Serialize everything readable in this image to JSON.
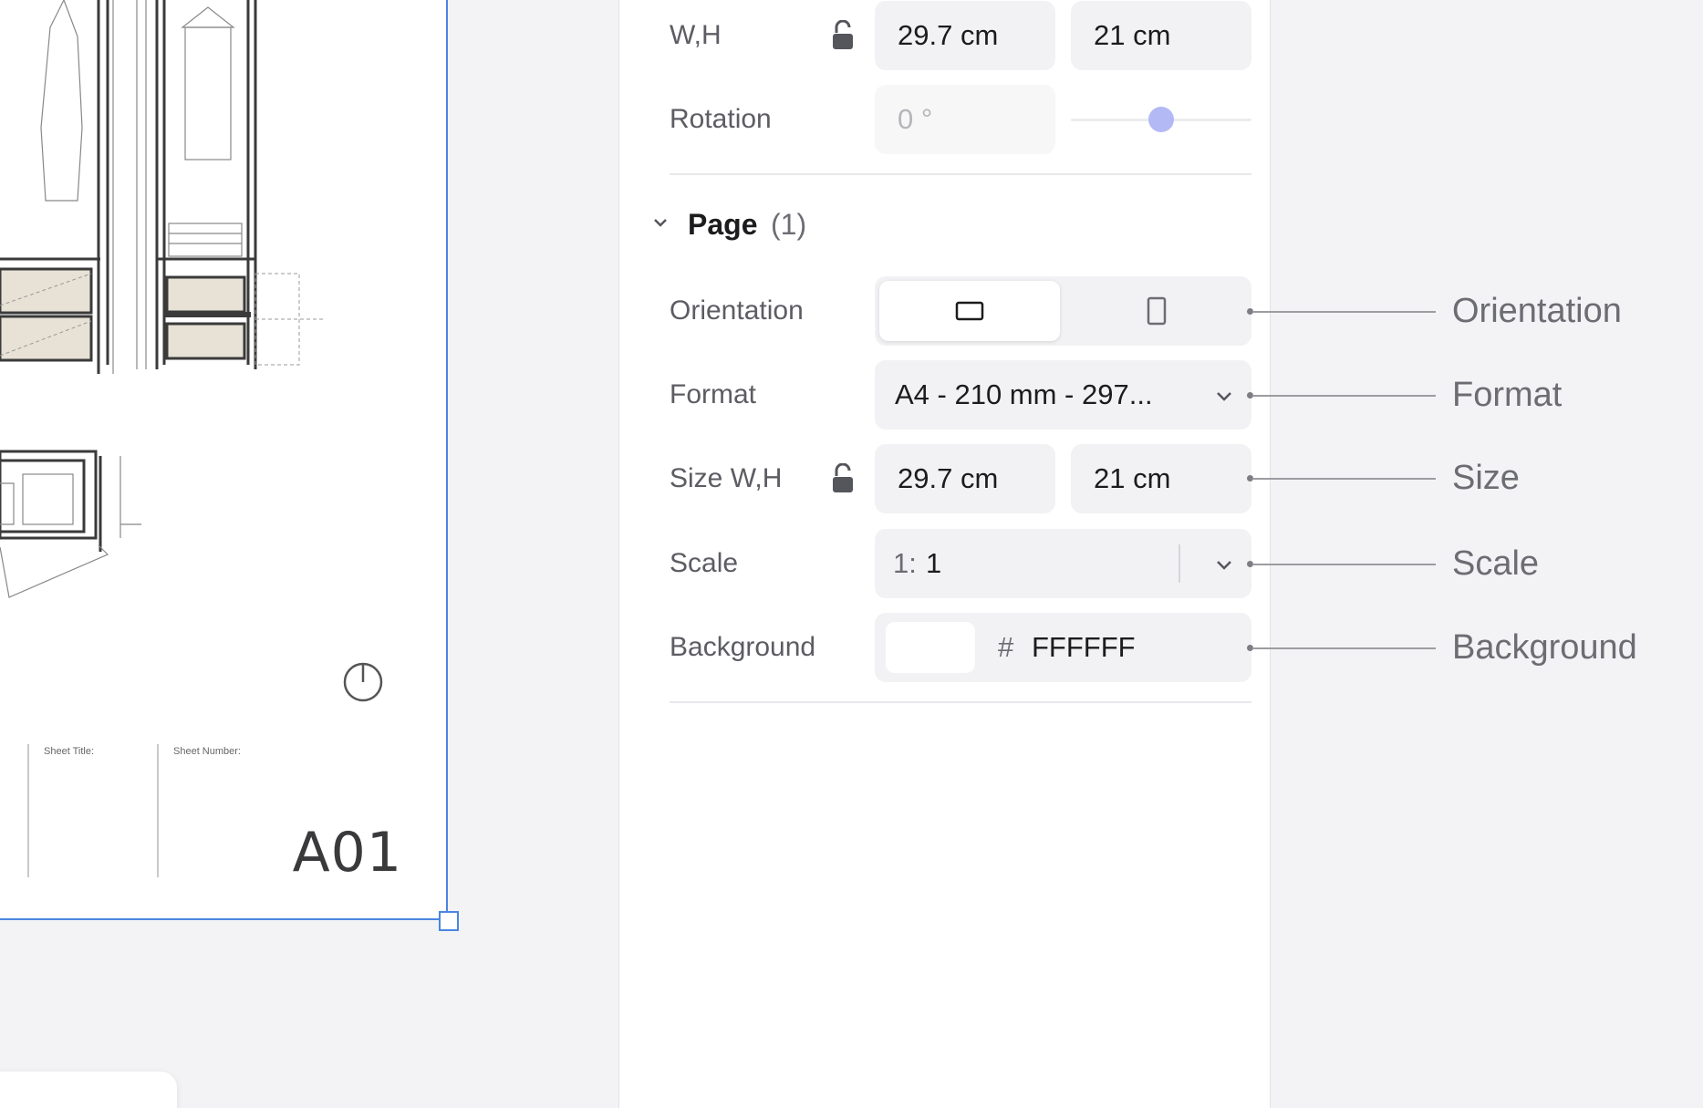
{
  "transform": {
    "wh_label": "W,H",
    "width_value": "29.7 cm",
    "height_value": "21 cm",
    "rotation_label": "Rotation",
    "rotation_value": "0 °",
    "rotation_level": 0.5
  },
  "page_section": {
    "title": "Page",
    "count": "(1)",
    "orientation_label": "Orientation",
    "orientation_selected": "landscape",
    "format_label": "Format",
    "format_value": "A4 - 210 mm - 297...",
    "size_label": "Size W,H",
    "size_width": "29.7 cm",
    "size_height": "21 cm",
    "scale_label": "Scale",
    "scale_prefix": "1:",
    "scale_value": "1",
    "background_label": "Background",
    "background_hash": "#",
    "background_hex": "FFFFFF"
  },
  "sheet": {
    "sheet_title_label": "Sheet Title:",
    "sheet_number_label": "Sheet Number:",
    "sheet_number_value": "A01"
  },
  "callouts": {
    "orientation": "Orientation",
    "format": "Format",
    "size": "Size",
    "scale": "Scale",
    "background": "Background"
  },
  "colors": {
    "selection_blue": "#4a86e0",
    "slider_knob": "#b3b9f5",
    "field_bg": "#f2f2f4"
  }
}
